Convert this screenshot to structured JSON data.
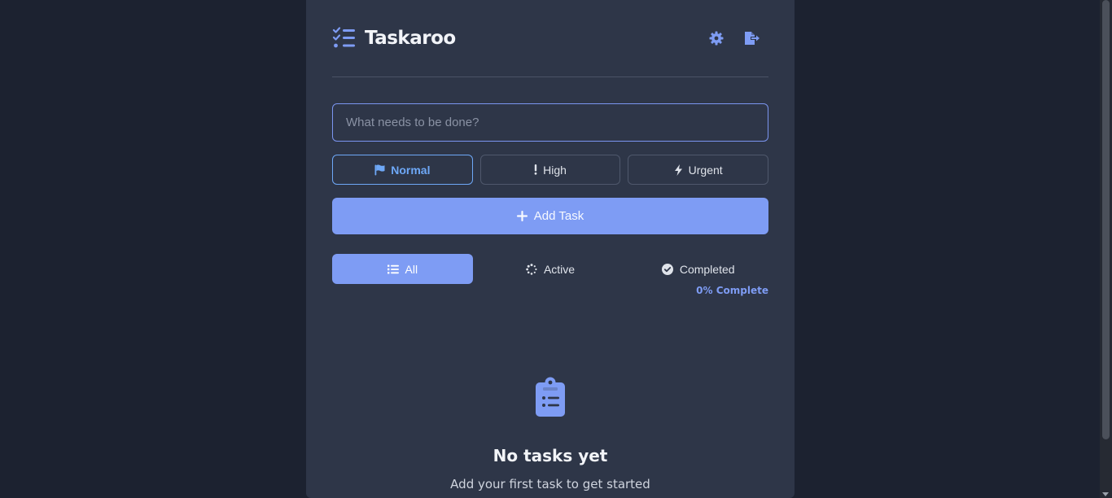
{
  "app": {
    "title": "Taskaroo",
    "logo_icon": "list-check-icon",
    "accent_color": "#7e9cf4"
  },
  "header": {
    "settings_icon": "gear-icon",
    "logout_icon": "logout-icon"
  },
  "task_input": {
    "placeholder": "What needs to be done?",
    "value": ""
  },
  "priority": {
    "selected": "Normal",
    "options": [
      {
        "label": "Normal",
        "icon": "flag-icon"
      },
      {
        "label": "High",
        "icon": "exclamation-icon"
      },
      {
        "label": "Urgent",
        "icon": "bolt-icon"
      }
    ]
  },
  "add_button": {
    "label": "Add Task",
    "icon": "plus-icon"
  },
  "filters": {
    "selected": "All",
    "tabs": [
      {
        "label": "All",
        "icon": "list-icon"
      },
      {
        "label": "Active",
        "icon": "spinner-icon"
      },
      {
        "label": "Completed",
        "icon": "check-circle-icon"
      }
    ]
  },
  "progress": {
    "text": "0% Complete",
    "percent": 0
  },
  "empty_state": {
    "icon": "clipboard-list-icon",
    "title": "No tasks yet",
    "subtitle": "Add your first task to get started"
  }
}
